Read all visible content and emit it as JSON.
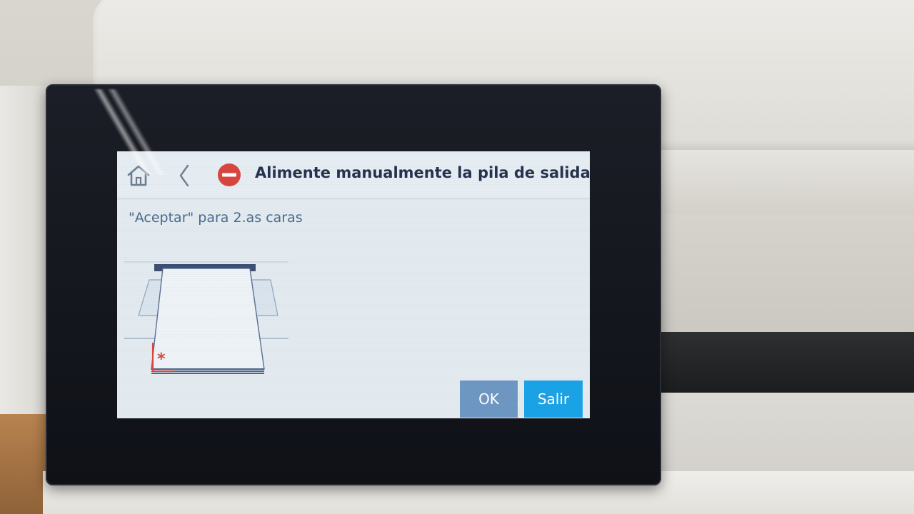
{
  "screen": {
    "title": "Alimente manualmente la pila de salida",
    "message": "\"Aceptar\" para 2.as caras",
    "icons": {
      "home": "home-icon",
      "back": "chevron-left-icon",
      "alert": "stop-icon",
      "illustration": "paper-stack-illustration"
    },
    "buttons": {
      "ok_label": "OK",
      "exit_label": "Salir"
    }
  },
  "colors": {
    "screen_bg": "#e3ebf1",
    "title_text": "#25334f",
    "message_text": "#4a6a8e",
    "alert_red": "#d9463f",
    "ok_button": "#6e97c3",
    "exit_button": "#1aa3e6",
    "bezel": "#14171e"
  }
}
